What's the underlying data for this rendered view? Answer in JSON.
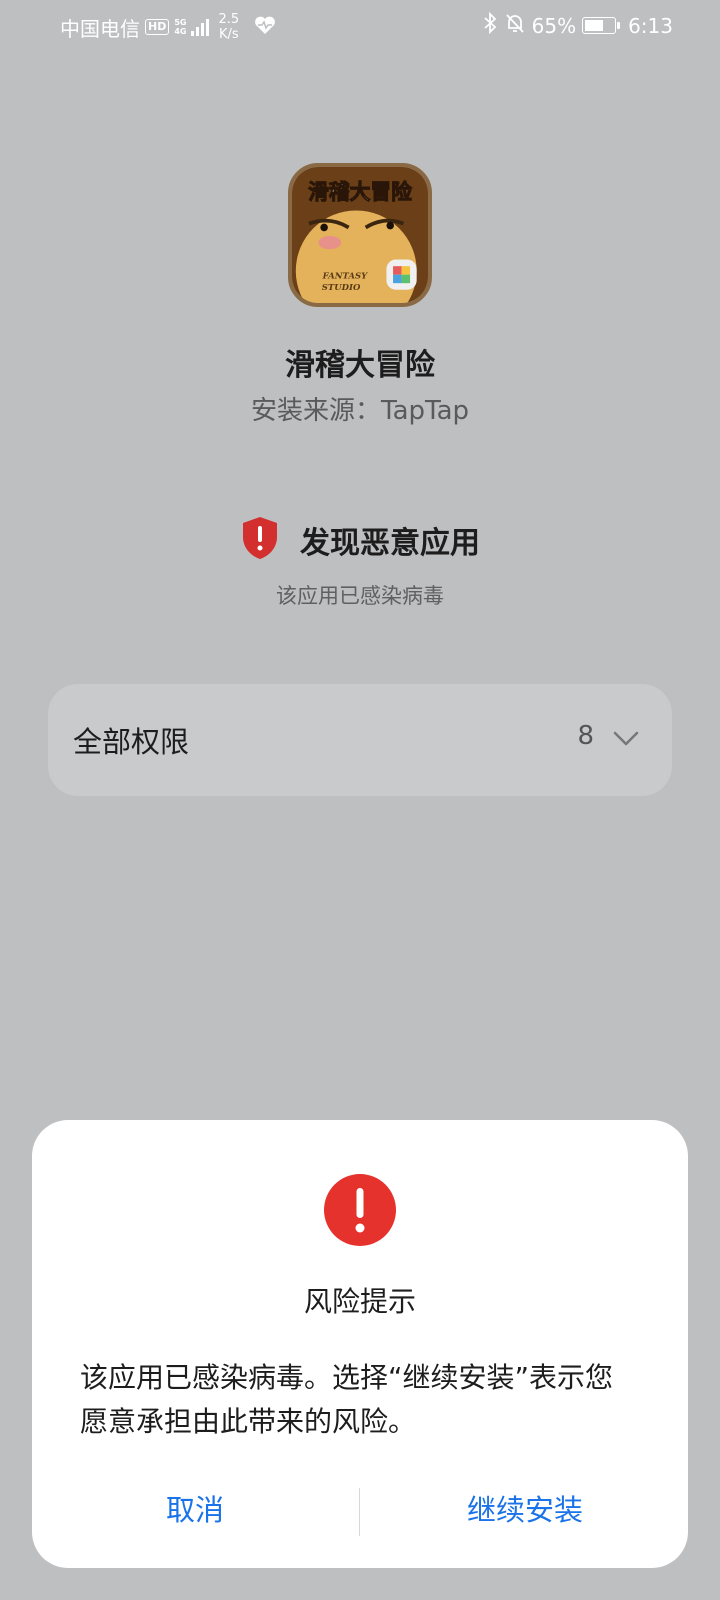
{
  "status_bar": {
    "carrier": "中国电信",
    "hd": "HD",
    "network_top": "5G",
    "network_bottom": "4G",
    "speed_value": "2.5",
    "speed_unit": "K/s",
    "battery_percent": "65%",
    "battery_level": 0.65,
    "time": "6:13"
  },
  "app": {
    "name": "滑稽大冒险",
    "source": "安装来源：TapTap",
    "icon_title": "滑稽大冒险",
    "icon_caption_1": "FANTASY",
    "icon_caption_2": "STUDIO"
  },
  "warning": {
    "title": "发现恶意应用",
    "subtitle": "该应用已感染病毒"
  },
  "permissions": {
    "label": "全部权限",
    "count": "8"
  },
  "dialog": {
    "title": "风险提示",
    "message": "该应用已感染病毒。选择“继续安装”表示您愿意承担由此带来的风险。",
    "cancel_label": "取消",
    "continue_label": "继续安装"
  },
  "colors": {
    "accent": "#1a73e8",
    "danger": "#e5322d",
    "shield": "#d32f2f"
  }
}
